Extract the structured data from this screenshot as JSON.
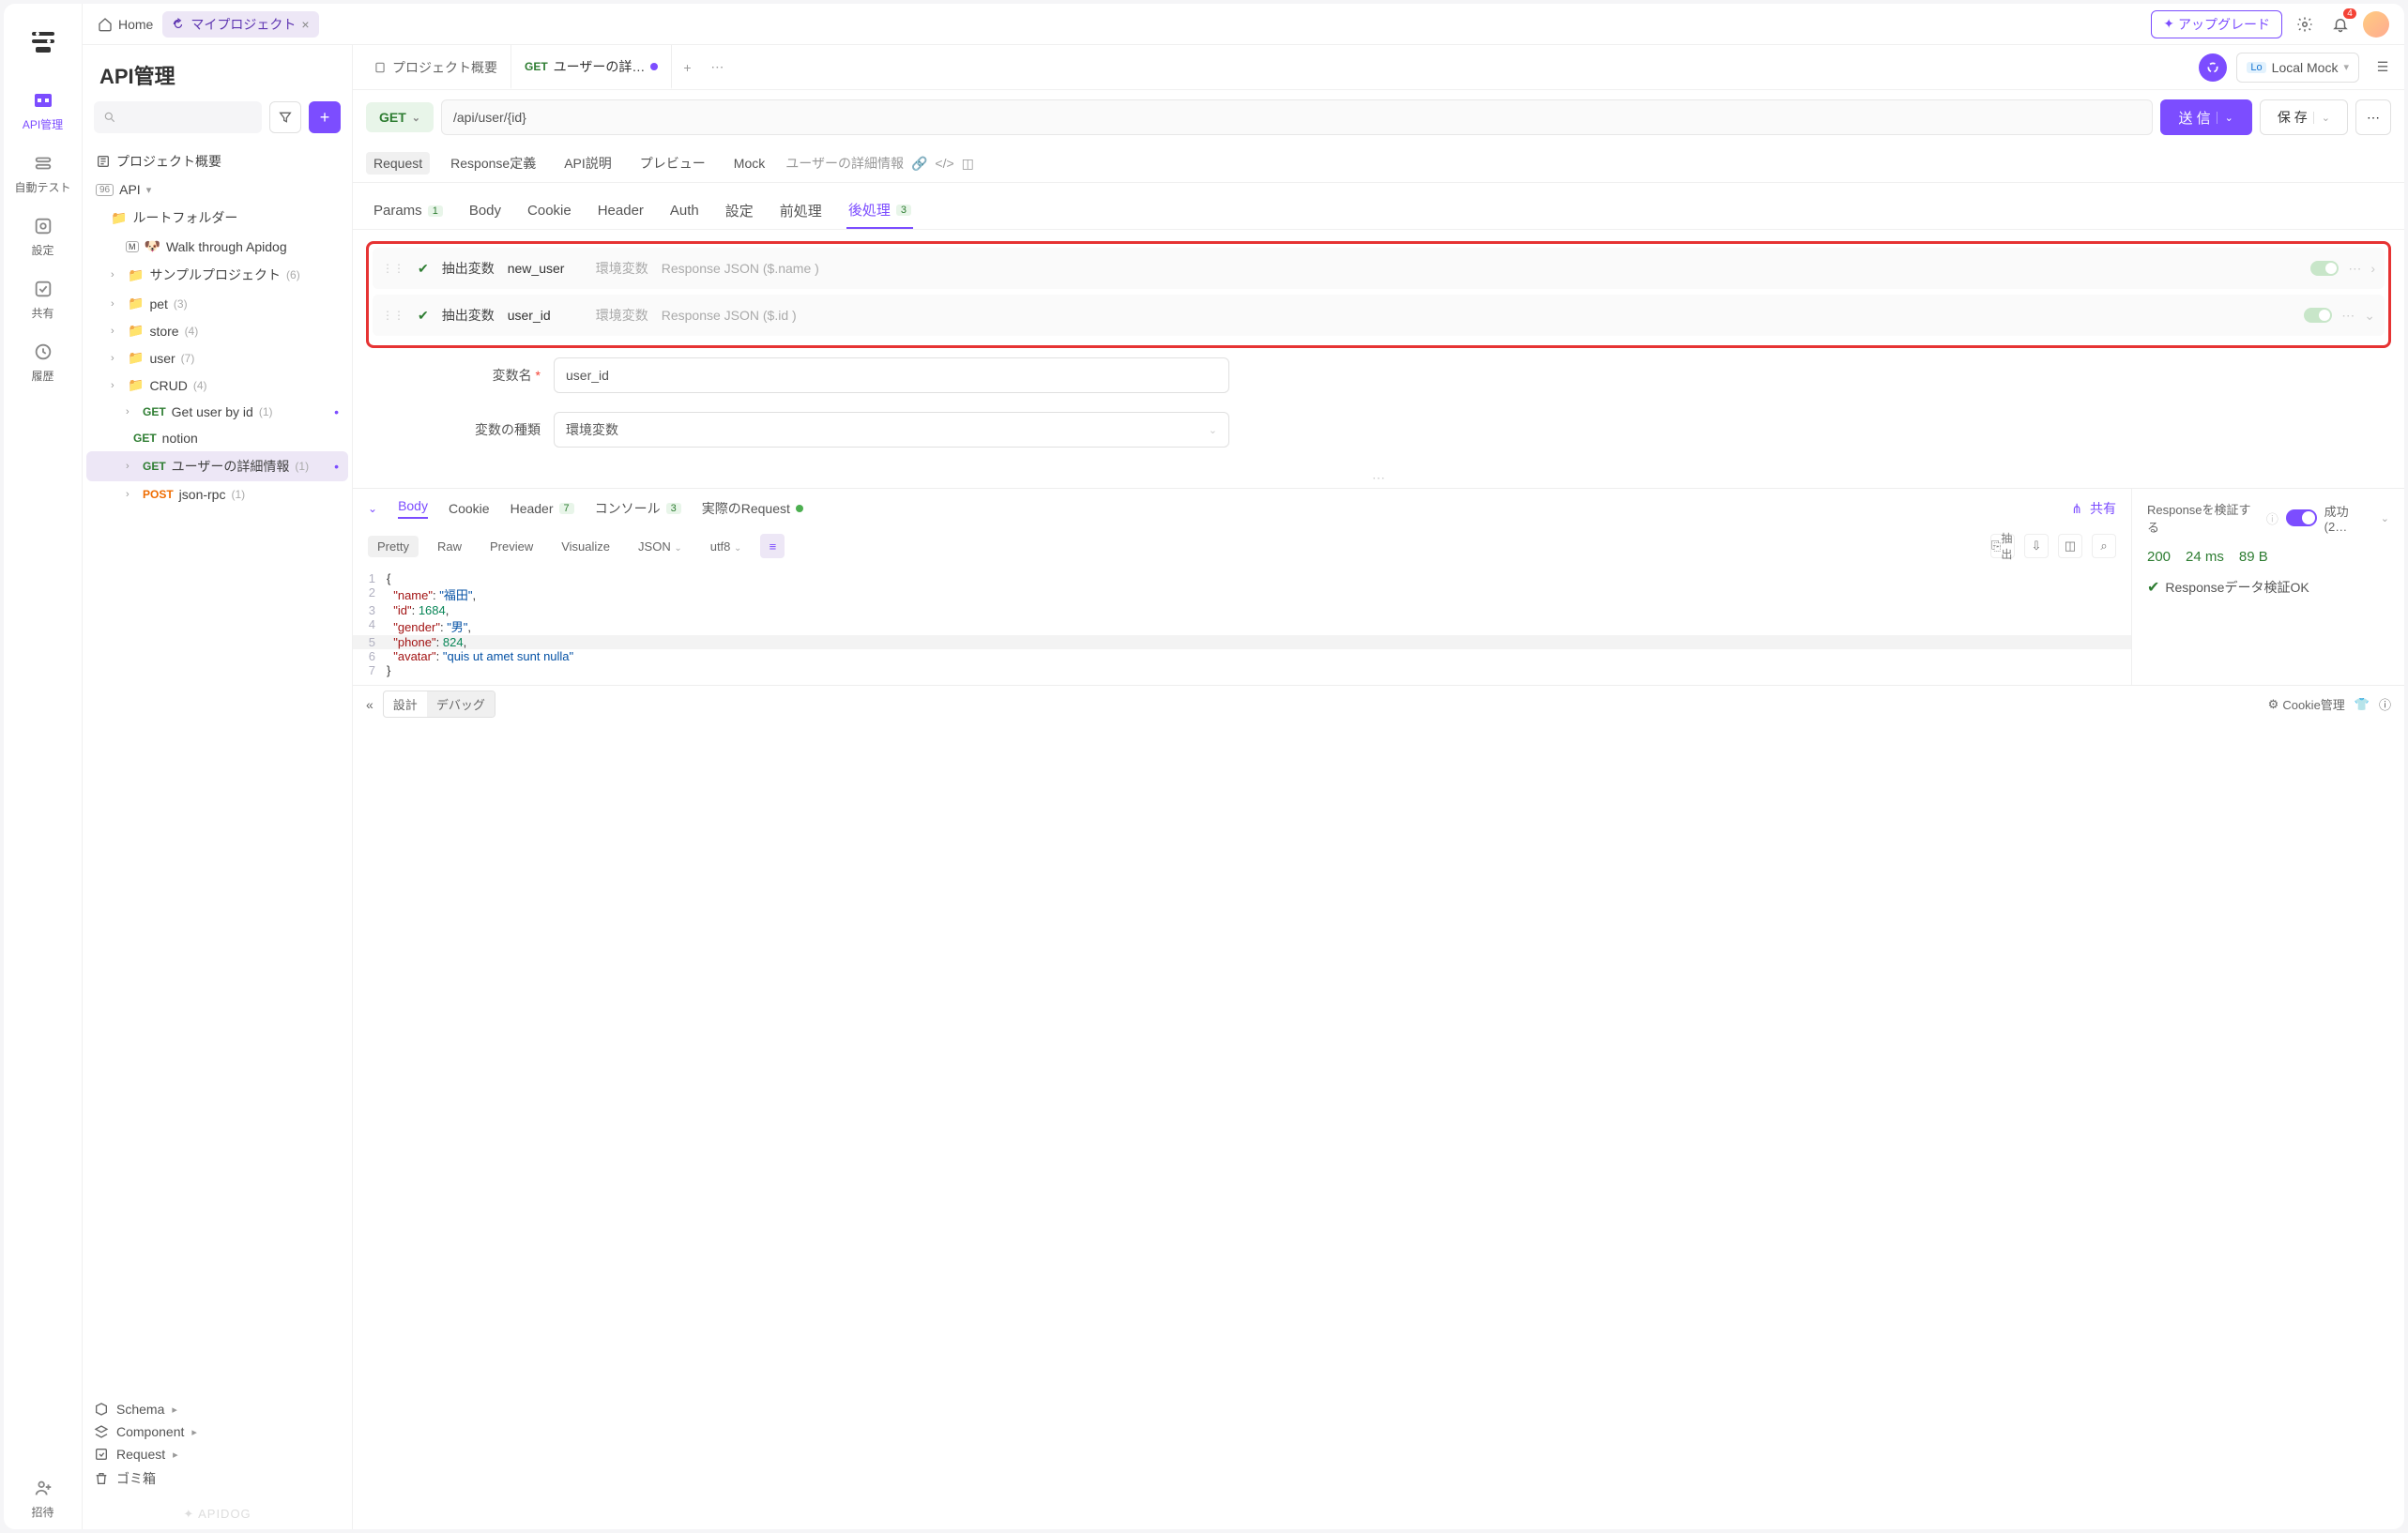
{
  "topbar": {
    "home": "Home",
    "project": "マイプロジェクト",
    "upgrade": "アップグレード",
    "notification_count": "4"
  },
  "rail": {
    "items": [
      {
        "label": "API管理",
        "active": true
      },
      {
        "label": "自動テスト"
      },
      {
        "label": "設定"
      },
      {
        "label": "共有"
      },
      {
        "label": "履歴"
      },
      {
        "label": "招待"
      }
    ]
  },
  "sidebar": {
    "title": "API管理",
    "overview": "プロジェクト概要",
    "api_label": "API",
    "root_folder": "ルートフォルダー",
    "walk_through": "Walk through Apidog",
    "folders": [
      {
        "name": "サンプルプロジェクト",
        "count": "(6)"
      },
      {
        "name": "pet",
        "count": "(3)"
      },
      {
        "name": "store",
        "count": "(4)"
      },
      {
        "name": "user",
        "count": "(7)"
      },
      {
        "name": "CRUD",
        "count": "(4)"
      }
    ],
    "endpoints": [
      {
        "method": "GET",
        "name": "Get user by id",
        "count": "(1)"
      },
      {
        "method": "GET",
        "name": "notion"
      },
      {
        "method": "GET",
        "name": "ユーザーの詳細情報",
        "count": "(1)",
        "selected": true
      },
      {
        "method": "POST",
        "name": "json-rpc",
        "count": "(1)"
      }
    ],
    "schema": "Schema",
    "component": "Component",
    "request": "Request",
    "trash": "ゴミ箱",
    "footer": "✦ APIDOG"
  },
  "tabs": {
    "overview": "プロジェクト概要",
    "active": {
      "method": "GET",
      "name": "ユーザーの詳…"
    },
    "env_lo": "Lo",
    "env_name": "Local Mock"
  },
  "request": {
    "method": "GET",
    "url": "/api/user/{id}",
    "send": "送 信",
    "save": "保 存"
  },
  "sub_tabs": {
    "items": [
      "Request",
      "Response定義",
      "API説明",
      "プレビュー",
      "Mock"
    ],
    "trail": "ユーザーの詳細情報"
  },
  "cfg_tabs": {
    "items": [
      {
        "label": "Params",
        "badge": "1"
      },
      {
        "label": "Body"
      },
      {
        "label": "Cookie"
      },
      {
        "label": "Header"
      },
      {
        "label": "Auth"
      },
      {
        "label": "設定"
      },
      {
        "label": "前処理"
      },
      {
        "label": "後処理",
        "badge": "3",
        "active": true
      }
    ]
  },
  "post_processing": {
    "rows": [
      {
        "label": "抽出変数",
        "name": "new_user",
        "scope": "環境変数",
        "expr": "Response JSON ($.name )",
        "expanded": false
      },
      {
        "label": "抽出変数",
        "name": "user_id",
        "scope": "環境変数",
        "expr": "Response JSON ($.id )",
        "expanded": true
      }
    ],
    "form": {
      "var_name_label": "変数名",
      "var_name_value": "user_id",
      "var_type_label": "変数の種類",
      "var_type_value": "環境変数"
    }
  },
  "response_tabs": {
    "items": [
      {
        "label": "Body",
        "active": true
      },
      {
        "label": "Cookie"
      },
      {
        "label": "Header",
        "badge": "7"
      },
      {
        "label": "コンソール",
        "badge": "3"
      },
      {
        "label": "実際のRequest",
        "dot": true
      }
    ],
    "share": "共有"
  },
  "response_toolbar": {
    "modes": [
      "Pretty",
      "Raw",
      "Preview",
      "Visualize"
    ],
    "format": "JSON",
    "encoding": "utf8",
    "extract": "抽出"
  },
  "response_body": {
    "lines": [
      {
        "n": "1",
        "c": "{"
      },
      {
        "n": "2",
        "c": "  \"name\": \"福田\","
      },
      {
        "n": "3",
        "c": "  \"id\": 1684,"
      },
      {
        "n": "4",
        "c": "  \"gender\": \"男\","
      },
      {
        "n": "5",
        "c": "  \"phone\": 824,"
      },
      {
        "n": "6",
        "c": "  \"avatar\": \"quis ut amet sunt nulla\""
      },
      {
        "n": "7",
        "c": "}"
      }
    ]
  },
  "validation": {
    "label": "Responseを検証する",
    "success": "成功 (2…",
    "metrics": {
      "status": "200",
      "time": "24 ms",
      "size": "89 B"
    },
    "ok_msg": "Responseデータ検証OK"
  },
  "footer": {
    "design": "設計",
    "debug": "デバッグ",
    "cookie": "Cookie管理"
  }
}
